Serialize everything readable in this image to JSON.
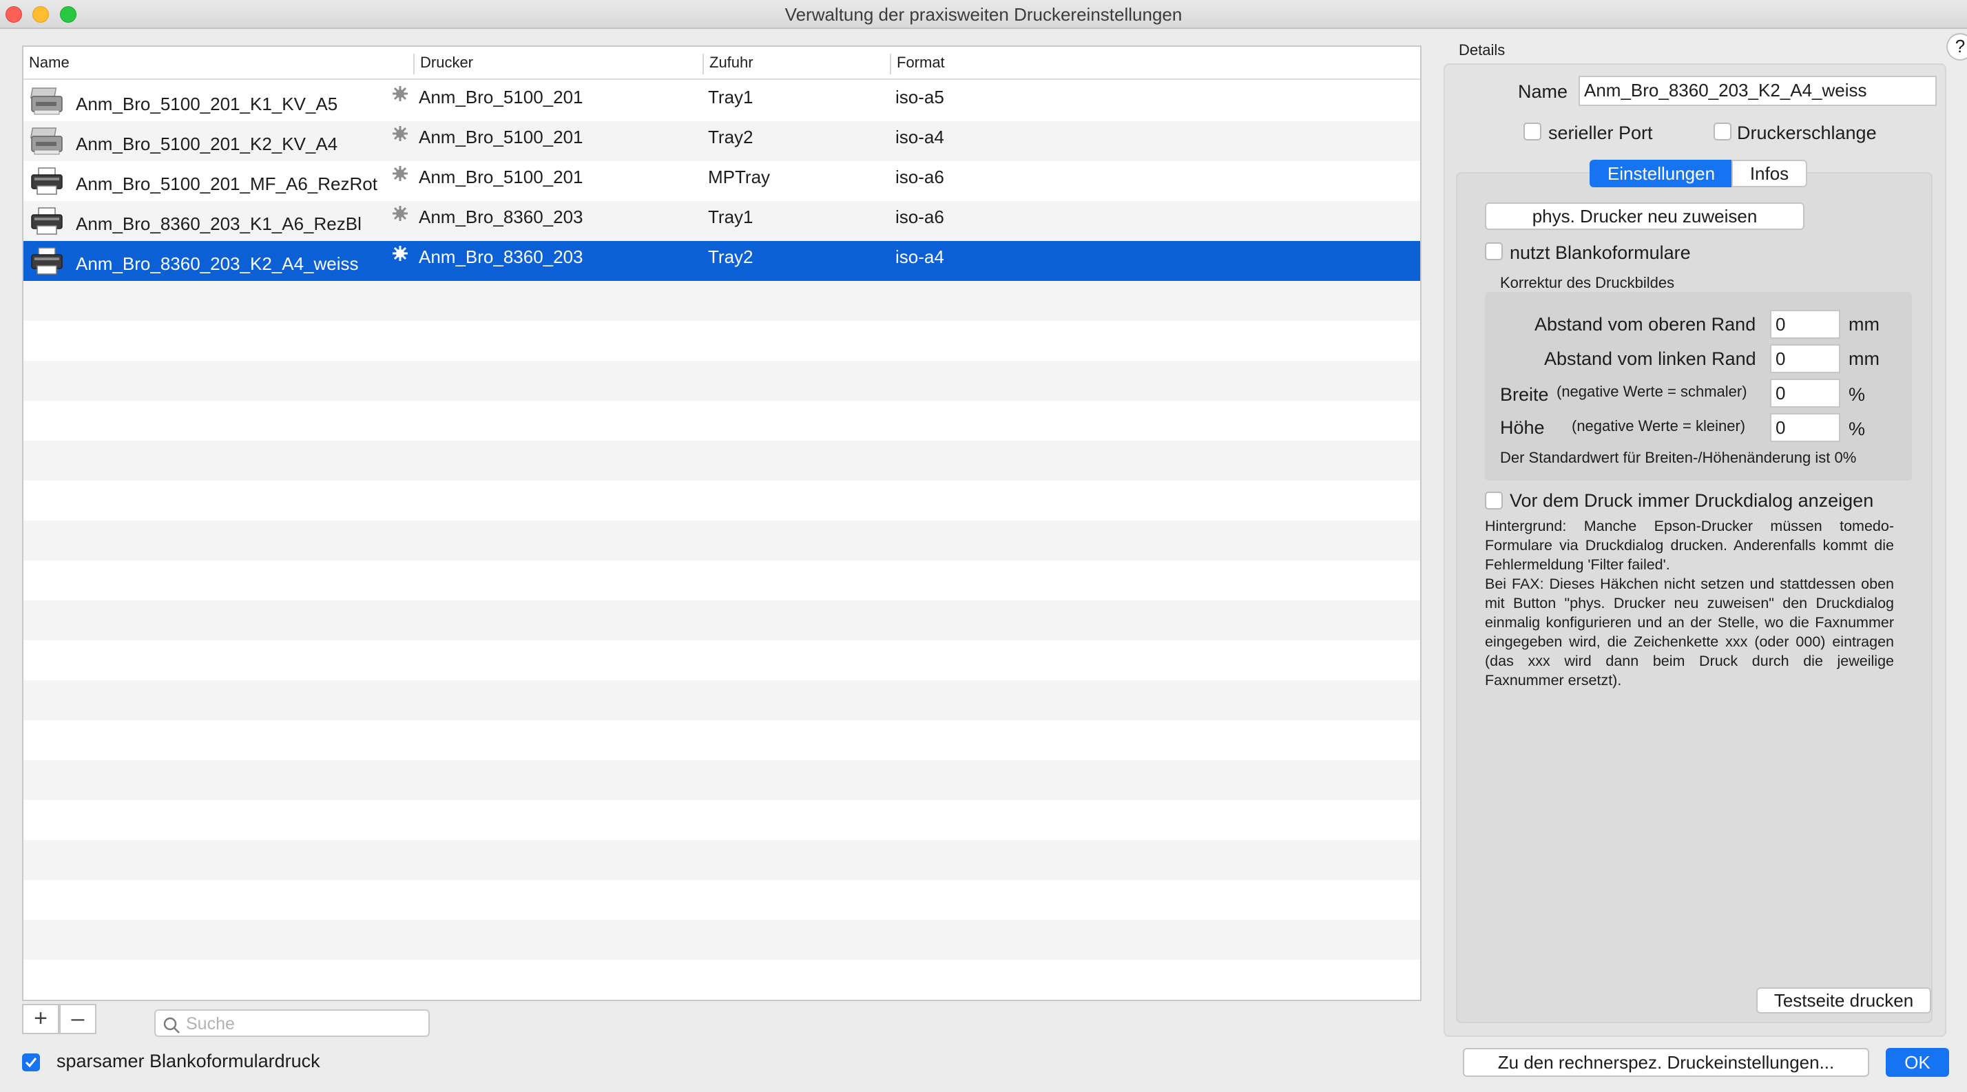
{
  "window": {
    "title": "Verwaltung der praxisweiten Druckereinstellungen"
  },
  "table": {
    "columns": [
      "Name",
      "Drucker",
      "Zufuhr",
      "Format"
    ],
    "rows": [
      {
        "name": "Anm_Bro_5100_201_K1_KV_A5",
        "printer": "Anm_Bro_5100_201",
        "tray": "Tray1",
        "format": "iso-a5",
        "icon": "laser-printer-icon",
        "selected": false
      },
      {
        "name": "Anm_Bro_5100_201_K2_KV_A4",
        "printer": "Anm_Bro_5100_201",
        "tray": "Tray2",
        "format": "iso-a4",
        "icon": "laser-printer-icon",
        "selected": false
      },
      {
        "name": "Anm_Bro_5100_201_MF_A6_RezRot",
        "printer": "Anm_Bro_5100_201",
        "tray": "MPTray",
        "format": "iso-a6",
        "icon": "printer-icon",
        "selected": false
      },
      {
        "name": "Anm_Bro_8360_203_K1_A6_RezBl",
        "printer": "Anm_Bro_8360_203",
        "tray": "Tray1",
        "format": "iso-a6",
        "icon": "printer-icon",
        "selected": false
      },
      {
        "name": "Anm_Bro_8360_203_K2_A4_weiss",
        "printer": "Anm_Bro_8360_203",
        "tray": "Tray2",
        "format": "iso-a4",
        "icon": "printer-icon",
        "selected": true
      }
    ]
  },
  "bottom": {
    "add_label": "+",
    "remove_label": "–",
    "search_placeholder": "Suche",
    "sparse_checkbox_label": "sparsamer Blankoformulardruck",
    "sparse_checked": true
  },
  "details": {
    "caption": "Details",
    "help_label": "?",
    "name_label": "Name",
    "name_value": "Anm_Bro_8360_203_K2_A4_weiss",
    "serial_port_label": "serieller Port",
    "queue_label": "Druckerschlange",
    "tabs": [
      "Einstellungen",
      "Infos"
    ],
    "reassign_button": "phys. Drucker neu zuweisen",
    "blank_forms_label": "nutzt Blankoformulare",
    "correction_caption": "Korrektur des Druckbildes",
    "top_margin_label": "Abstand vom oberen Rand",
    "top_margin_value": "0",
    "top_margin_unit": "mm",
    "left_margin_label": "Abstand vom linken Rand",
    "left_margin_value": "0",
    "left_margin_unit": "mm",
    "width_label": "Breite",
    "width_hint": "(negative Werte = schmaler)",
    "width_value": "0",
    "width_unit": "%",
    "height_label": "Höhe",
    "height_hint": "(negative Werte = kleiner)",
    "height_value": "0",
    "height_unit": "%",
    "default_note": "Der Standardwert für Breiten-/Höhenänderung ist 0%",
    "dialog_label": "Vor dem Druck immer Druckdialog anzeigen",
    "background_text_1": "Hintergrund: Manche Epson-Drucker müssen tomedo-Formulare via Druckdialog drucken. Anderenfalls kommt die Fehlermeldung 'Filter failed'.",
    "background_text_2": "Bei FAX: Dieses Häkchen nicht setzen und stattdessen oben mit Button \"phys. Drucker neu zuweisen\" den Druckdialog einmalig konfigurieren und an der Stelle, wo die Faxnummer eingegeben wird, die Zeichenkette xxx (oder 000) eintragen (das xxx wird dann beim Druck durch die jeweilige Faxnummer ersetzt).",
    "test_page_button": "Testseite drucken"
  },
  "footer": {
    "machine_settings_button": "Zu den rechnerspez. Druckeinstellungen...",
    "ok_button": "OK"
  },
  "colors": {
    "accent": "#1673f1",
    "selection": "#0b60d6"
  }
}
